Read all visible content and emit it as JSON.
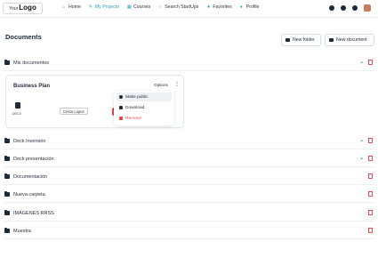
{
  "logo": {
    "small": "Your",
    "big": "Logo"
  },
  "nav": [
    {
      "label": "Home",
      "icon": "home-icon"
    },
    {
      "label": "My Projects",
      "icon": "projects-icon",
      "active": true
    },
    {
      "label": "Courses",
      "icon": "courses-icon"
    },
    {
      "label": "Search StartUps",
      "icon": "search-icon"
    },
    {
      "label": "Favorites",
      "icon": "star-icon"
    },
    {
      "label": "Profile",
      "icon": "user-icon"
    }
  ],
  "page": {
    "title": "Documents"
  },
  "buttons": {
    "new_folder": "New folder",
    "new_document": "New document"
  },
  "folders": [
    {
      "label": "Mis documentos",
      "expanded": true
    },
    {
      "label": "Deck Inversión",
      "expandable": true
    },
    {
      "label": "Deck presentación",
      "expandable": true
    },
    {
      "label": "Documentación"
    },
    {
      "label": "Nueva carpeta"
    },
    {
      "label": "IMÁGENES RRSS"
    },
    {
      "label": "Muestra"
    }
  ],
  "doc_card": {
    "title": "Business Plan",
    "options_label": "Options",
    "file_ext": "DOCX",
    "author": "César López"
  },
  "dropdown": {
    "items": [
      {
        "label": "Make public",
        "icon": "eye-icon"
      },
      {
        "label": "Download",
        "icon": "lock-icon"
      },
      {
        "label": "Remove",
        "icon": "trash-icon",
        "danger": true
      }
    ]
  },
  "colors": {
    "accent": "#2aa3b9",
    "danger": "#e5484d",
    "text": "#1f2a37"
  }
}
